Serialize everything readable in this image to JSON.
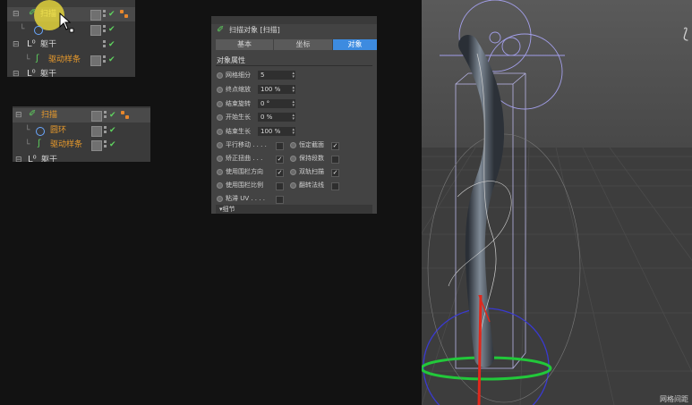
{
  "object_manager_top": {
    "items": [
      {
        "label": "扫描",
        "highlighted": true
      },
      {
        "label": ""
      },
      {
        "label": "躯干"
      },
      {
        "label": "驱动样条",
        "orange": true
      },
      {
        "label": "躯干"
      }
    ]
  },
  "object_manager_bottom": {
    "items": [
      {
        "label": "扫描",
        "orange": true
      },
      {
        "label": "圆环",
        "orange": true
      },
      {
        "label": "驱动样条",
        "orange": true
      },
      {
        "label": "躯干"
      }
    ]
  },
  "attributes": {
    "title": "扫描对象 [扫描]",
    "tabs": [
      "基本",
      "坐标",
      "对象"
    ],
    "active_tab": "对象",
    "section": "对象属性",
    "params": [
      {
        "label": "网格细分",
        "value": "5"
      },
      {
        "label": "终点缩放",
        "value": "100 %"
      },
      {
        "label": "结束旋转",
        "value": "0 °"
      },
      {
        "label": "开始生长",
        "value": "0 %"
      },
      {
        "label": "结束生长",
        "value": "100 %"
      }
    ],
    "options": [
      {
        "label": "平行移动 . . . .",
        "checked": false,
        "label2": "恒定截面",
        "checked2": true
      },
      {
        "label": "矫正扭曲 . . .",
        "checked": true,
        "label2": "保持段数",
        "checked2": false
      },
      {
        "label": "使用围栏方向",
        "checked": true,
        "label2": "双轨扫描",
        "checked2": true
      },
      {
        "label": "使用围栏比例",
        "checked": false,
        "label2": "翻转法线",
        "checked2": false
      },
      {
        "label": "粘滞 UV . . . .",
        "checked": false
      }
    ],
    "details_label": "▾细节"
  },
  "viewport": {
    "status": "网格间距"
  },
  "colors": {
    "accent_tab": "#3d8be0",
    "orange_label": "#e89a2c",
    "check": "#5fd35f"
  }
}
